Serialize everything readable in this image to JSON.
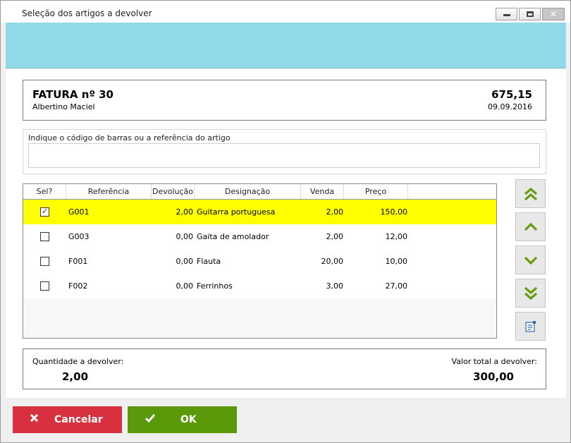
{
  "window": {
    "title": "Seleção dos artigos a devolver"
  },
  "invoice": {
    "title": "FATURA nº 30",
    "client": "Albertino Maciel",
    "total": "675,15",
    "date": "09.09.2016"
  },
  "barcode": {
    "label": "Indique o código de barras ou a referência do artigo",
    "value": "",
    "placeholder": ""
  },
  "table": {
    "headers": {
      "sel": "Sel?",
      "ref": "Referência",
      "dev": "Devolução",
      "des": "Designação",
      "venda": "Venda",
      "preco": "Preço"
    },
    "rows": [
      {
        "checked": true,
        "ref": "G001",
        "dev": "2,00",
        "des": "Guitarra portuguesa",
        "venda": "2,00",
        "preco": "150,00"
      },
      {
        "checked": false,
        "ref": "G003",
        "dev": "0,00",
        "des": "Gaita de amolador",
        "venda": "2,00",
        "preco": "12,00"
      },
      {
        "checked": false,
        "ref": "F001",
        "dev": "0,00",
        "des": "Flauta",
        "venda": "20,00",
        "preco": "10,00"
      },
      {
        "checked": false,
        "ref": "F002",
        "dev": "0,00",
        "des": "Ferrinhos",
        "venda": "3,00",
        "preco": "27,00"
      }
    ],
    "selected_row": 0
  },
  "side_buttons": [
    "double-chevron-up-icon",
    "chevron-up-icon",
    "chevron-down-icon",
    "double-chevron-down-icon",
    "details-icon"
  ],
  "summary": {
    "qty_label": "Quantidade a devolver:",
    "qty_value": "2,00",
    "total_label": "Valor total a devolver:",
    "total_value": "300,00"
  },
  "buttons": {
    "cancel_label": "Cancelar",
    "ok_label": "OK"
  },
  "colors": {
    "banner": "#8fd9e8",
    "selected_row": "#ffff00",
    "cancel": "#d9303f",
    "ok": "#5a9a0a",
    "nav_arrow": "#6a9a12"
  }
}
